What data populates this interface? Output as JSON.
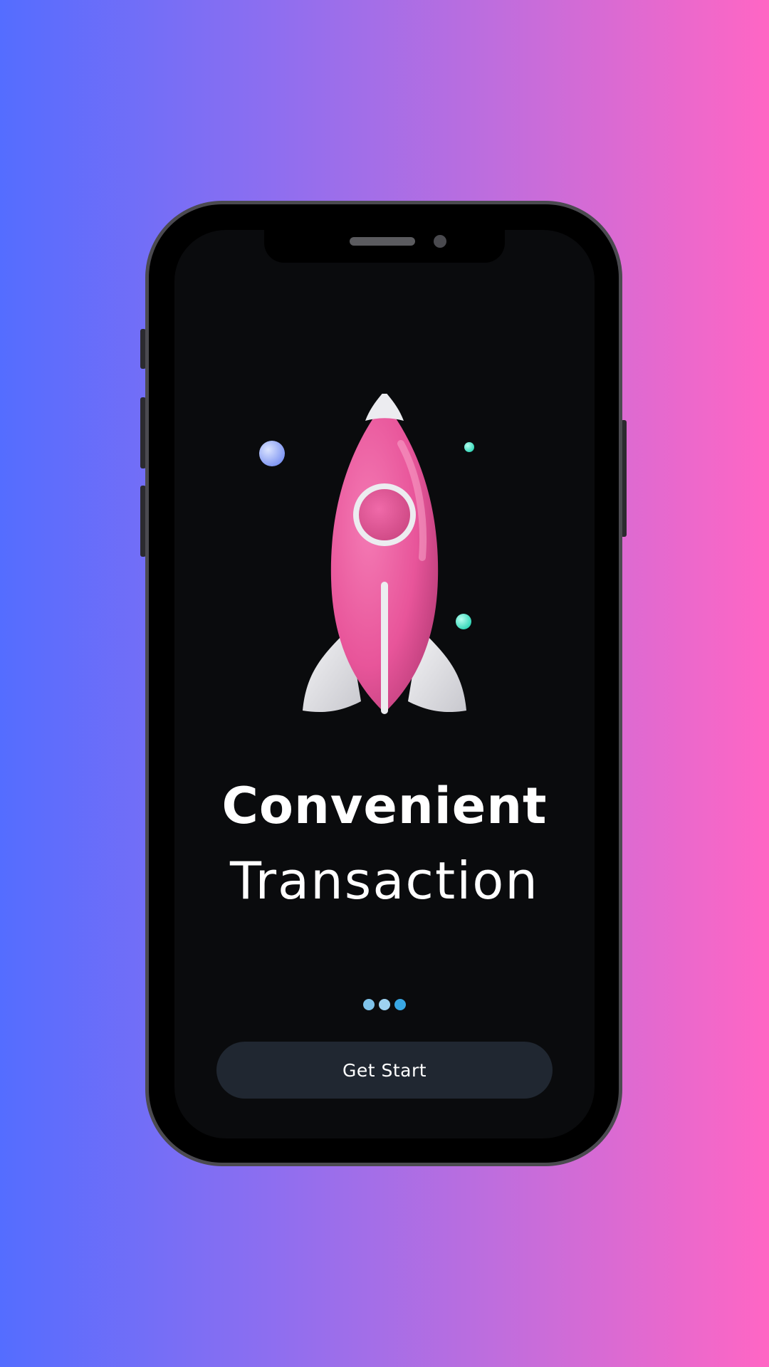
{
  "onboarding": {
    "title_line1": "Convenient",
    "title_line2": "Transaction",
    "cta_label": "Get Start",
    "page_indicator": {
      "total": 3,
      "colors": [
        "#7fc3ea",
        "#9ed2f0",
        "#39a7e4"
      ]
    }
  },
  "illustration": {
    "subject": "rocket-icon",
    "rocket_color": "#e8559a",
    "fin_color": "#e6e6ea"
  },
  "colors": {
    "background_gradient": [
      "#546dff",
      "#ff66c4"
    ],
    "screen": "#0a0b0d",
    "button": "#202731"
  }
}
